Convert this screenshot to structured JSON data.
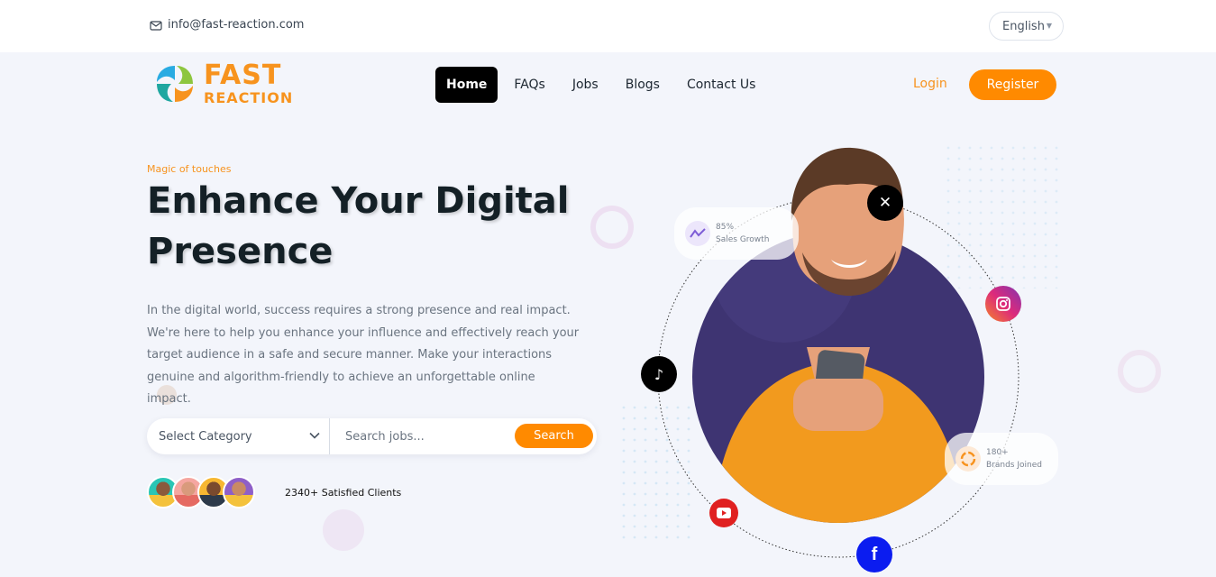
{
  "topbar": {
    "email": "info@fast-reaction.com",
    "language": "English"
  },
  "brand": {
    "line1": "FAST",
    "line2": "REACTION"
  },
  "nav": {
    "items": [
      "Home",
      "FAQs",
      "Jobs",
      "Blogs",
      "Contact Us"
    ],
    "active": "Home"
  },
  "auth": {
    "login": "Login",
    "register": "Register"
  },
  "hero": {
    "eyebrow": "Magic of touches",
    "title_line1": "Enhance Your Digital",
    "title_line2": "Presence",
    "description": "In the digital world, success requires a strong presence and real impact. We're here to help you enhance your influence and effectively reach your target audience in a safe and secure manner. Make your interactions genuine and algorithm-friendly to achieve an unforgettable online impact."
  },
  "search": {
    "category_selected": "Select Category",
    "placeholder": "Search jobs...",
    "button": "Search"
  },
  "clients": {
    "label": "2340+ Satisfied Clients"
  },
  "stats": {
    "growth_value": "85%",
    "growth_label": "Sales Growth",
    "brands_value": "180+",
    "brands_label": "Brands Joined"
  },
  "colors": {
    "accent": "#ff8a00",
    "brand_orange": "#f7931e",
    "circle_purple": "#3e3472"
  },
  "icons": {
    "social": [
      "x-icon",
      "instagram-icon",
      "tiktok-icon",
      "youtube-icon",
      "facebook-icon"
    ]
  }
}
